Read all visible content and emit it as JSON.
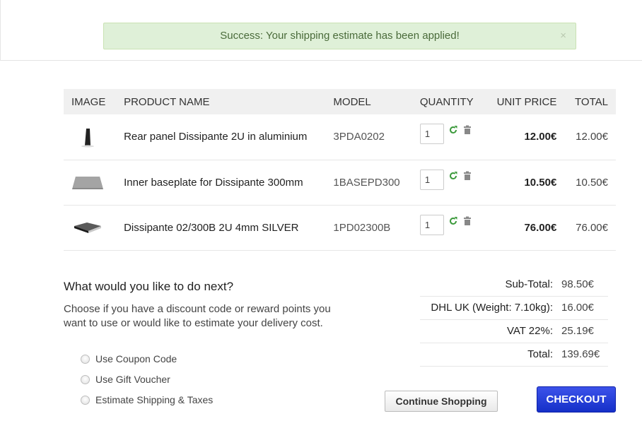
{
  "alert": {
    "message": "Success: Your shipping estimate has been applied!",
    "close_glyph": "×"
  },
  "cart": {
    "headers": [
      "IMAGE",
      "PRODUCT NAME",
      "MODEL",
      "QUANTITY",
      "UNIT PRICE",
      "TOTAL"
    ],
    "rows": [
      {
        "image_icon": "panel-product-icon",
        "name": "Rear panel Dissipante 2U in aluminium",
        "model": "3PDA0202",
        "quantity": "1",
        "unit_price": "12.00€",
        "total": "12.00€"
      },
      {
        "image_icon": "baseplate-product-icon",
        "name": "Inner baseplate for Dissipante 300mm",
        "model": "1BASEPD300",
        "quantity": "1",
        "unit_price": "10.50€",
        "total": "10.50€"
      },
      {
        "image_icon": "enclosure-product-icon",
        "name": "Dissipante 02/300B 2U 4mm SILVER",
        "model": "1PD02300B",
        "quantity": "1",
        "unit_price": "76.00€",
        "total": "76.00€"
      }
    ]
  },
  "next": {
    "title": "What would you like to do next?",
    "description": "Choose if you have a discount code or reward points you want to use or would like to estimate your delivery cost.",
    "options": [
      "Use Coupon Code",
      "Use Gift Voucher",
      "Estimate Shipping & Taxes"
    ]
  },
  "totals": [
    {
      "label": "Sub-Total:",
      "value": "98.50€"
    },
    {
      "label": "DHL UK (Weight: 7.10kg):",
      "value": "16.00€"
    },
    {
      "label": "VAT 22%:",
      "value": "25.19€"
    },
    {
      "label": "Total:",
      "value": "139.69€"
    }
  ],
  "buttons": {
    "continue": "Continue Shopping",
    "checkout": "CHECKOUT"
  },
  "colors": {
    "alert_bg": "#dff0d8",
    "update_icon": "#3c9a3c",
    "checkout_bg": "#1c36d8"
  }
}
